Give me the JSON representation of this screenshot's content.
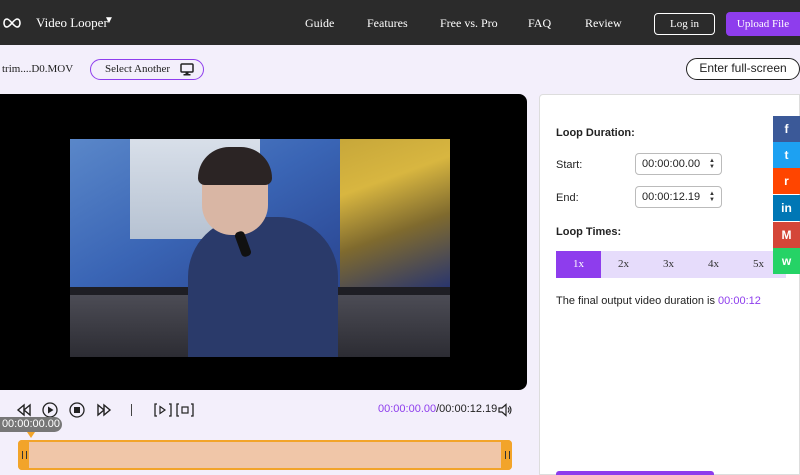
{
  "nav": {
    "brand": "Video Looper",
    "links": [
      "Guide",
      "Features",
      "Free vs. Pro",
      "FAQ",
      "Review"
    ],
    "login_label": "Log in",
    "upload_label": "Upload File"
  },
  "file": {
    "name": "trim....D0.MOV",
    "select_label": "Select Another",
    "fullscreen_label": "Enter full-screen"
  },
  "player": {
    "current_time": "00:00:00.00",
    "total_time": "/00:00:12.19",
    "bubble_time": "00:00:00.00"
  },
  "settings": {
    "loop_duration_label": "Loop Duration:",
    "start_label": "Start:",
    "start_value": "00:00:00.00",
    "end_label": "End:",
    "end_value": "00:00:12.19",
    "loop_times_label": "Loop Times:",
    "loop_options": [
      "1x",
      "2x",
      "3x",
      "4x",
      "5x"
    ],
    "selected_option": "1x",
    "final_text": "The final output video duration is ",
    "final_duration": "00:00:12"
  },
  "social": [
    {
      "name": "facebook-icon",
      "glyph": "f",
      "color": "#3b5998"
    },
    {
      "name": "twitter-icon",
      "glyph": "t",
      "color": "#1da1f2"
    },
    {
      "name": "reddit-icon",
      "glyph": "r",
      "color": "#ff4500"
    },
    {
      "name": "linkedin-icon",
      "glyph": "in",
      "color": "#0077b5"
    },
    {
      "name": "gmail-icon",
      "glyph": "M",
      "color": "#d44638"
    },
    {
      "name": "whatsapp-icon",
      "glyph": "w",
      "color": "#25d366"
    }
  ],
  "colors": {
    "accent": "#8e3ded",
    "timeline": "#f2a42a",
    "nav_bg": "#2b2b2b"
  }
}
